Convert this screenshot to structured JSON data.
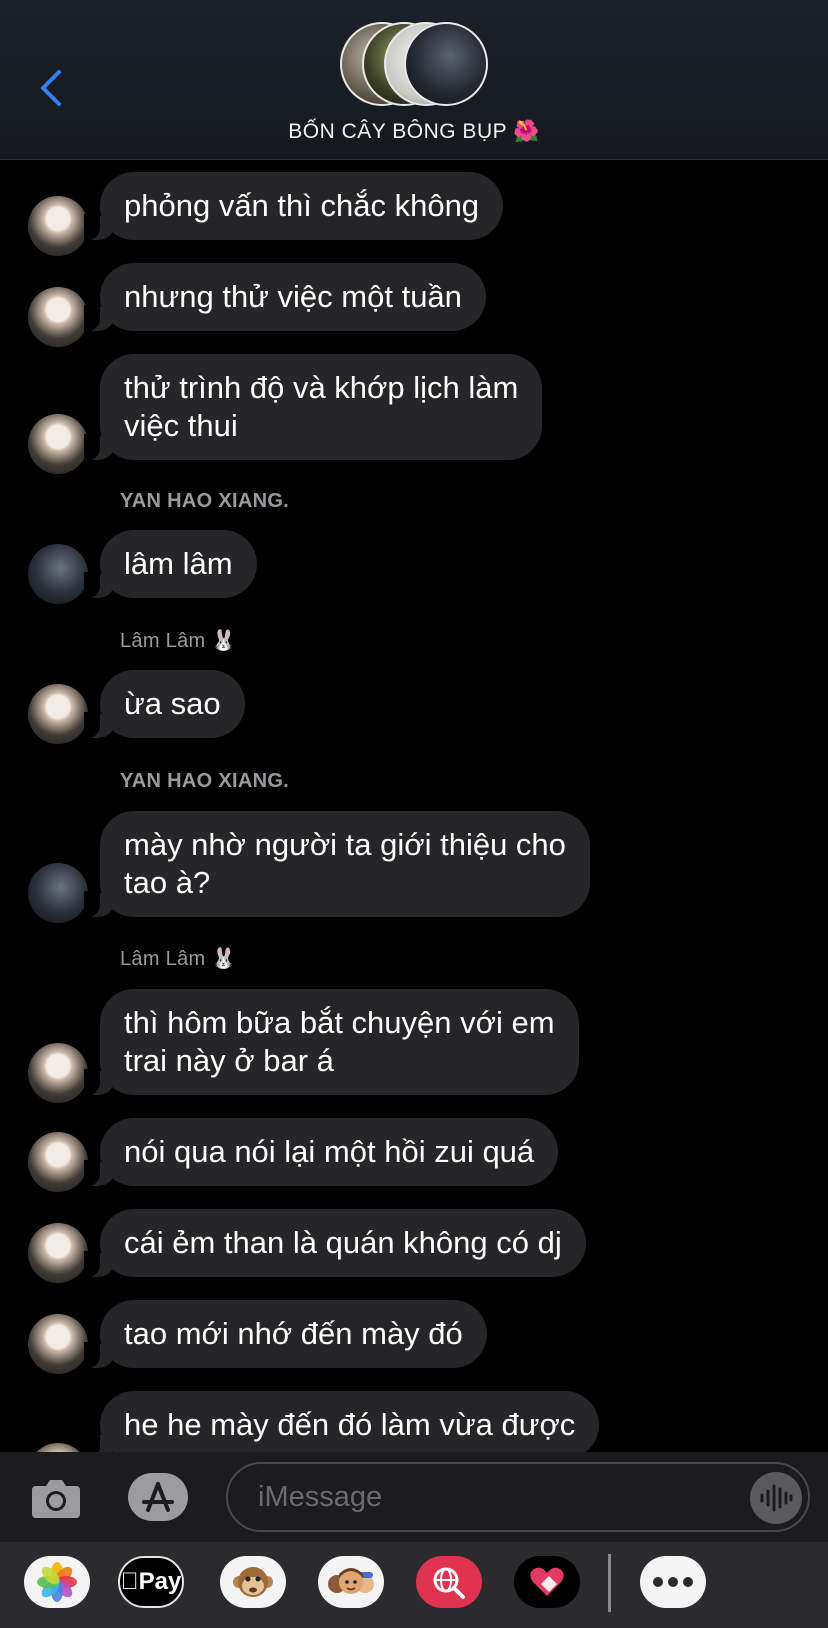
{
  "header": {
    "back_icon": "chevron-left-icon",
    "title": "BỐN CÂY BÔNG BỤP 🌺",
    "accent_color": "#2f80f2",
    "member_avatar_count": 4
  },
  "messages": [
    {
      "kind": "bubble",
      "sender": "lam",
      "text": "phỏng vấn thì chắc không"
    },
    {
      "kind": "bubble",
      "sender": "lam",
      "text": "nhưng thử việc một tuần"
    },
    {
      "kind": "bubble",
      "sender": "lam",
      "text": "thử trình độ và khớp lịch làm\nviệc thui"
    },
    {
      "kind": "sender_label",
      "text": "YAN HAO XIANG."
    },
    {
      "kind": "bubble",
      "sender": "yan",
      "text": "lâm lâm"
    },
    {
      "kind": "sender_label",
      "text": "Lâm Lâm 🐰"
    },
    {
      "kind": "bubble",
      "sender": "lam",
      "text": "ừa sao"
    },
    {
      "kind": "sender_label",
      "text": "YAN HAO XIANG."
    },
    {
      "kind": "bubble",
      "sender": "yan",
      "text": "mày nhờ người ta giới thiệu cho\ntao à?"
    },
    {
      "kind": "sender_label",
      "text": "Lâm Lâm 🐰"
    },
    {
      "kind": "bubble",
      "sender": "lam",
      "text": "thì hôm bữa bắt chuyện với em\ntrai này ở bar á"
    },
    {
      "kind": "bubble",
      "sender": "lam",
      "text": "nói qua nói lại một hồi zui quá"
    },
    {
      "kind": "bubble",
      "sender": "lam",
      "text": "cái ẻm than là quán không có dj"
    },
    {
      "kind": "bubble",
      "sender": "lam",
      "text": "tao mới nhớ đến mày đó"
    },
    {
      "kind": "bubble",
      "sender": "lam",
      "text": "he he mày đến đó làm vừa được"
    }
  ],
  "input": {
    "placeholder": "iMessage",
    "camera_icon": "camera-icon",
    "apps_icon": "app-store-icon",
    "audio_icon": "audio-waveform-icon"
  },
  "drawer": {
    "apps": [
      {
        "name": "photos-app-icon",
        "label": ""
      },
      {
        "name": "apple-pay-icon",
        "label": "Pay"
      },
      {
        "name": "animoji-icon",
        "label": ""
      },
      {
        "name": "memoji-icon",
        "label": ""
      },
      {
        "name": "web-search-icon",
        "label": ""
      },
      {
        "name": "digital-touch-icon",
        "label": ""
      },
      {
        "name": "more-apps-icon",
        "label": ""
      }
    ]
  }
}
